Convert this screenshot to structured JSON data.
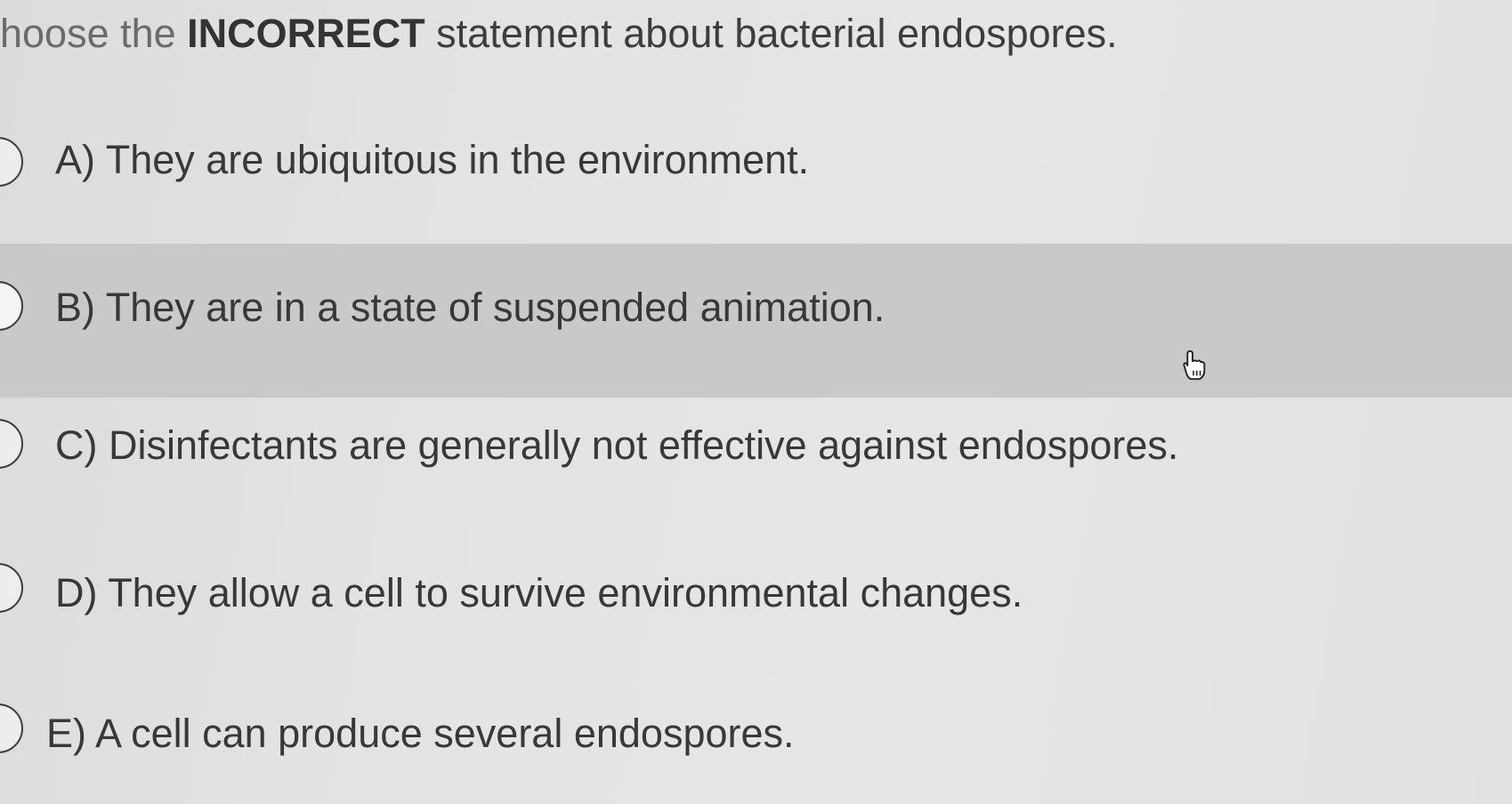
{
  "question": {
    "prefix": "hoose the ",
    "emphasis": "INCORRECT",
    "suffix": " statement about bacterial endospores."
  },
  "choices": [
    {
      "letter": "A)",
      "text": "They are ubiquitous in the environment."
    },
    {
      "letter": "B)",
      "text": "They are in a state of suspended animation."
    },
    {
      "letter": "C)",
      "text": "Disinfectants are generally not effective against endospores."
    },
    {
      "letter": "D)",
      "text": "They allow a cell to survive environmental changes."
    },
    {
      "letter": "E)",
      "text": "A cell can produce several endospores."
    }
  ],
  "hovered_choice": "B)",
  "icons": {
    "cursor": "hand-pointer-icon",
    "radio": "radio-button-icon"
  },
  "colors": {
    "background": "#e3e3e3",
    "hover_row": "#c9c9c9",
    "text": "#383838"
  }
}
